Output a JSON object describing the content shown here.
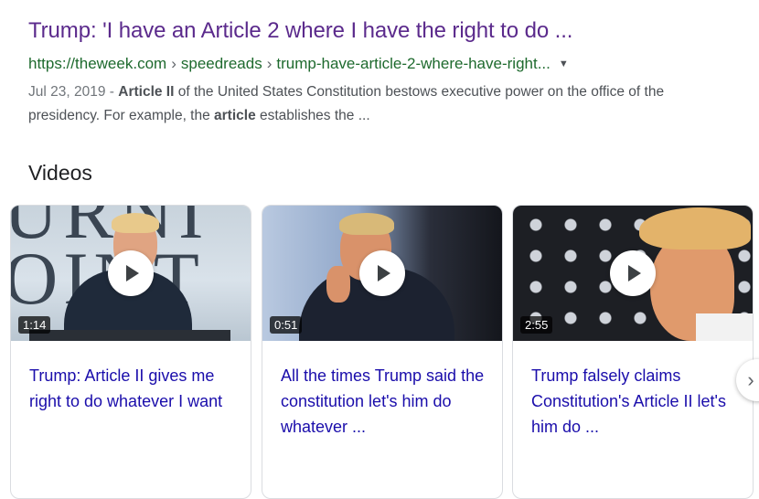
{
  "result": {
    "title": "Trump: 'I have an Article 2 where I have the right to do ...",
    "url_domain": "https://theweek.com",
    "url_sep": "›",
    "url_path1": "speedreads",
    "url_path2": "trump-have-article-2-where-have-right...",
    "date": "Jul 23, 2019",
    "date_sep": " - ",
    "snippet_bold1": "Article II",
    "snippet_text1": " of the United States Constitution bestows executive power on the office of the presidency. For example, the ",
    "snippet_bold2": "article",
    "snippet_text2": " establishes the ..."
  },
  "videos": {
    "heading": "Videos",
    "cards": [
      {
        "duration": "1:14",
        "title": "Trump: Article II gives me right to do whatever I want",
        "thumb_text": "URNI OINT"
      },
      {
        "duration": "0:51",
        "title": "All the times Trump said the constitution let's him do whatever ..."
      },
      {
        "duration": "2:55",
        "title": "Trump falsely claims Constitution's Article II let's him do ..."
      }
    ]
  },
  "icons": {
    "dropdown": "caret-down-icon",
    "play": "play-icon",
    "next": "chevron-right-icon"
  },
  "colors": {
    "title_visited": "#5b2a8c",
    "url_green": "#1e6a2e",
    "link_blue": "#1a0dab"
  }
}
